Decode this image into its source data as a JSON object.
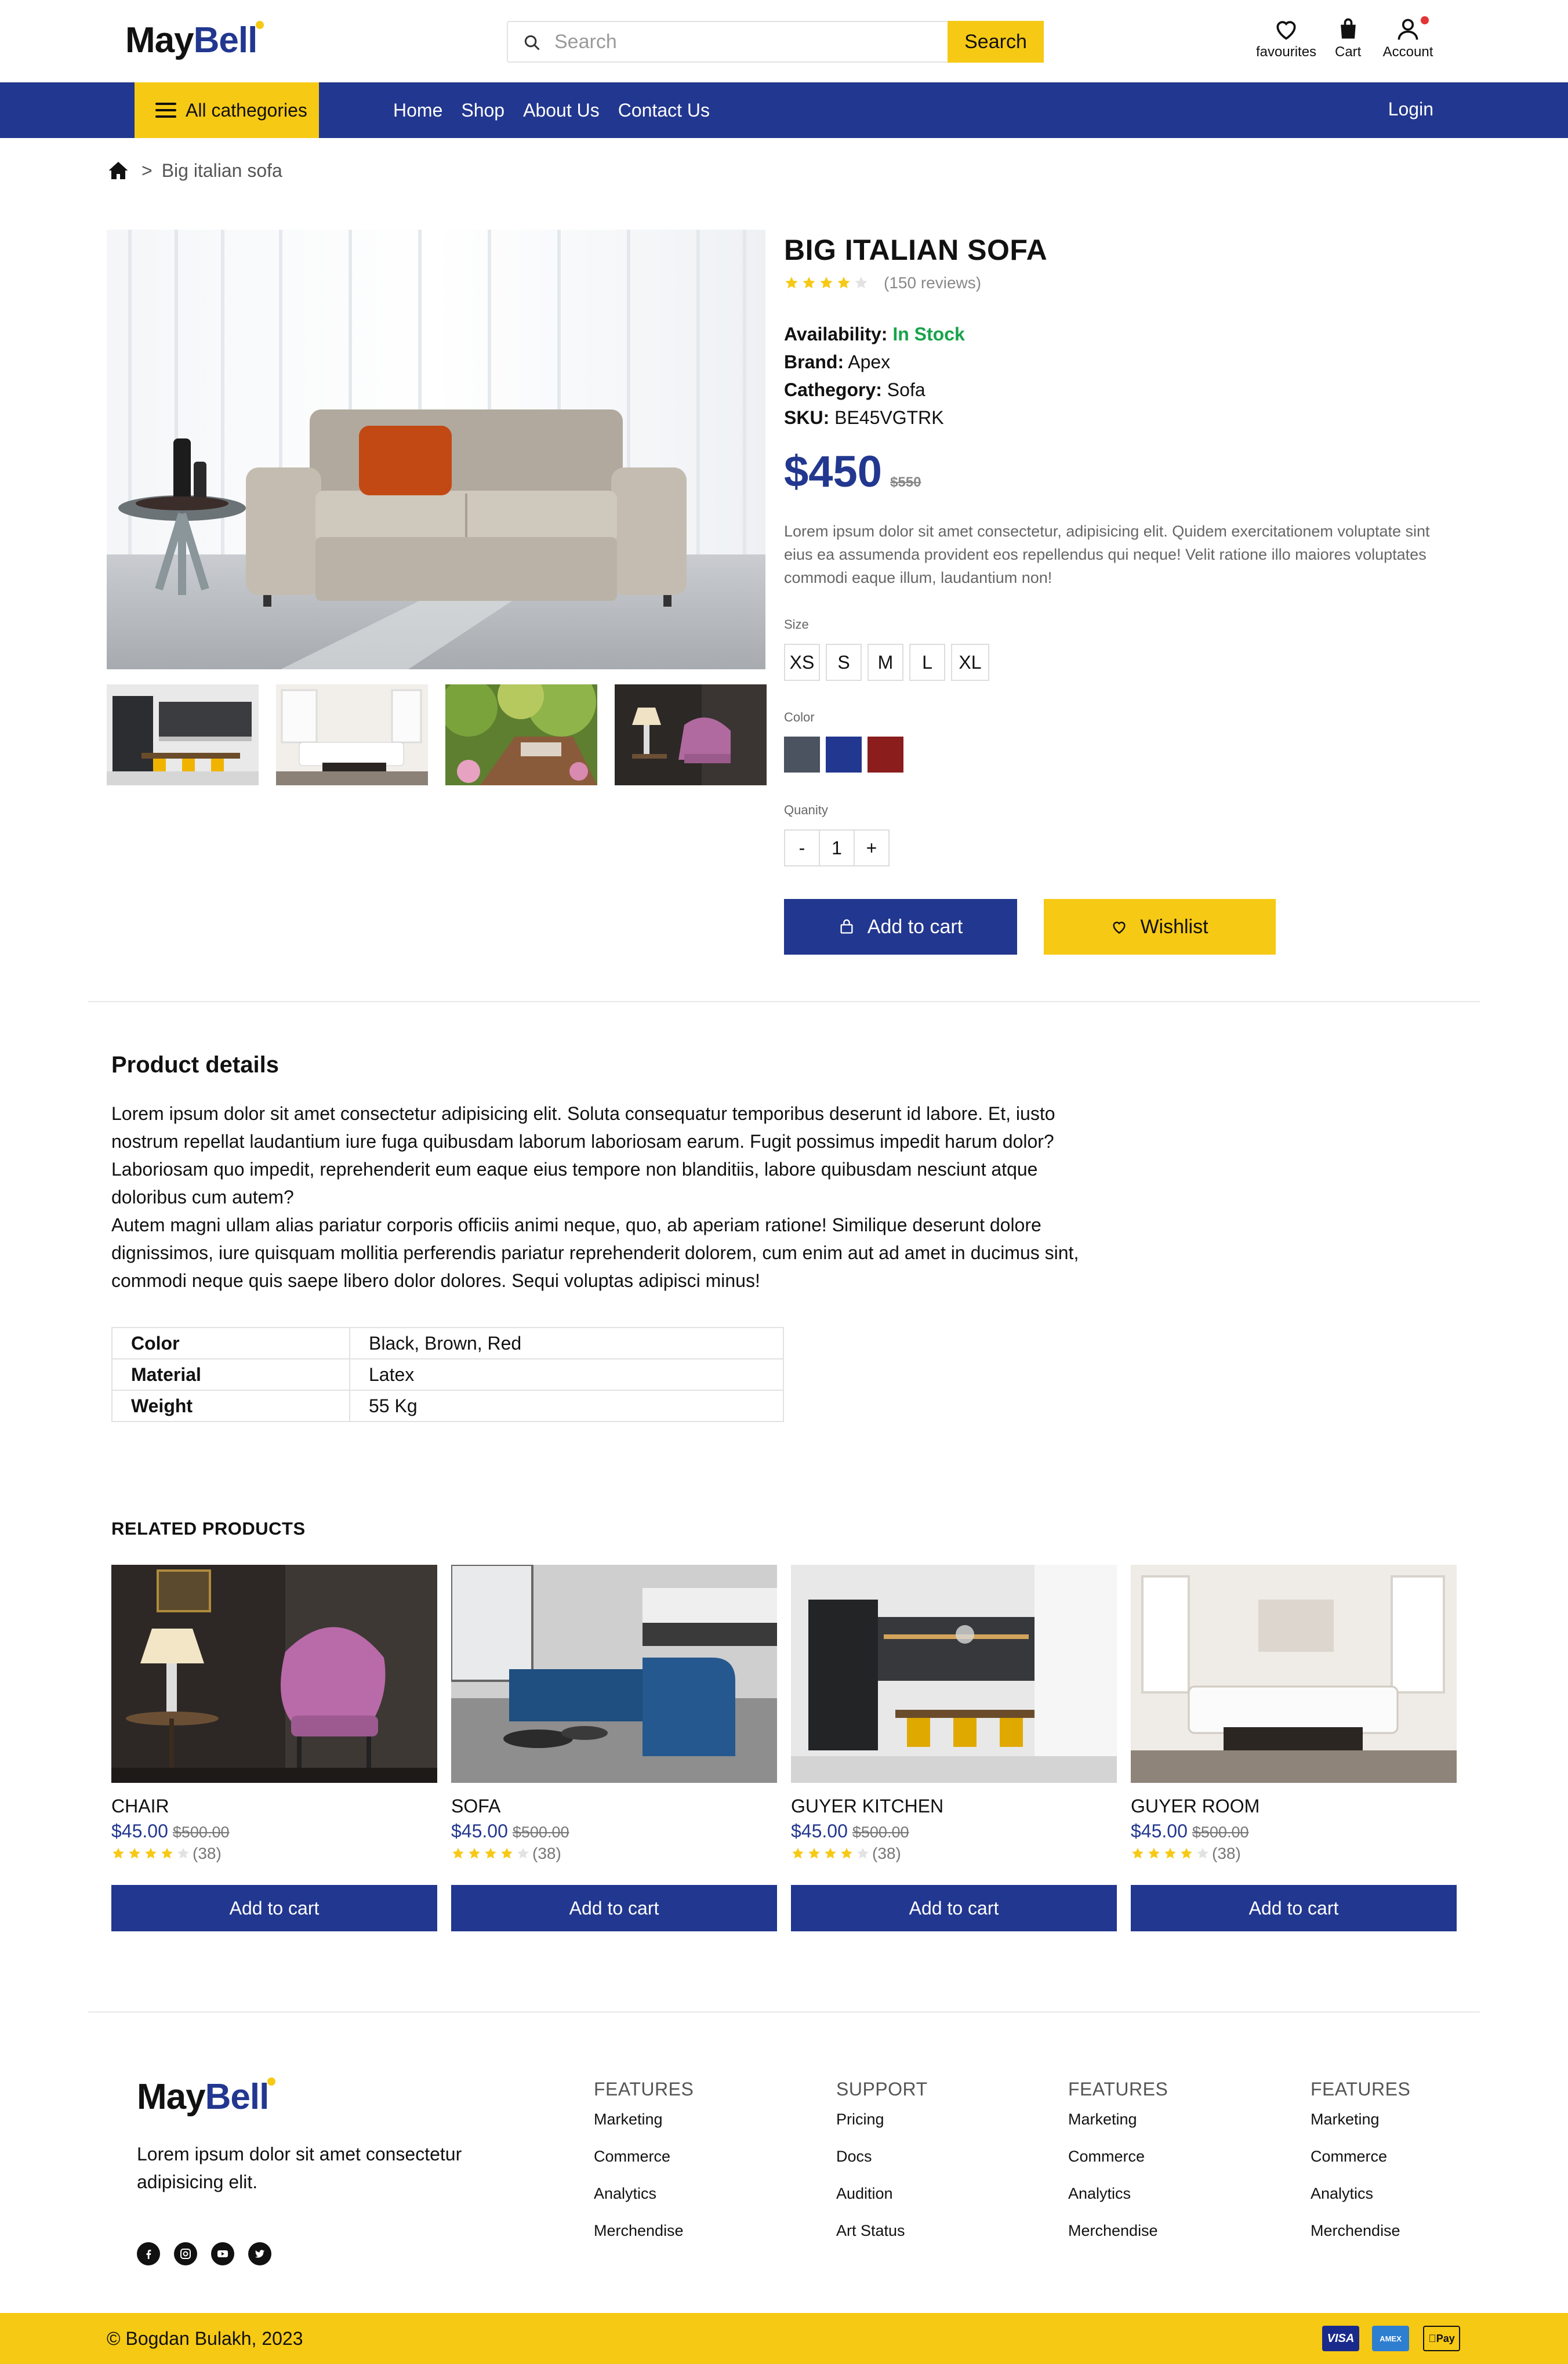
{
  "header": {
    "logo_part1": "May",
    "logo_part2": "Bell",
    "search_placeholder": "Search",
    "search_button": "Search",
    "favourites": "favourites",
    "cart": "Cart",
    "account": "Account"
  },
  "nav": {
    "categories": "All cathegories",
    "links": [
      "Home",
      "Shop",
      "About Us",
      "Contact Us"
    ],
    "login": "Login"
  },
  "breadcrumb": {
    "separator": ">",
    "current": "Big italian sofa"
  },
  "product": {
    "title": "BIG ITALIAN SOFA",
    "rating": 4,
    "reviews": "(150 reviews)",
    "availability_label": "Availability:",
    "availability": "In Stock",
    "brand_label": "Brand:",
    "brand": "Apex",
    "category_label": "Cathegory:",
    "category": "Sofa",
    "sku_label": "SKU:",
    "sku": "BE45VGTRK",
    "price": "$450",
    "old_price": "$550",
    "description": "Lorem ipsum dolor sit amet consectetur, adipisicing elit. Quidem exercitationem voluptate sint eius ea assumenda provident eos repellendus qui neque! Velit ratione illo maiores voluptates commodi eaque illum, laudantium non!",
    "size_label": "Size",
    "sizes": [
      "XS",
      "S",
      "M",
      "L",
      "XL"
    ],
    "color_label": "Color",
    "colors": [
      "#4b5260",
      "#22378f",
      "#8b1d1d"
    ],
    "quantity_label": "Quanity",
    "qty_minus": "-",
    "quantity": "1",
    "qty_plus": "+",
    "add_to_cart": "Add to cart",
    "wishlist": "Wishlist"
  },
  "details": {
    "title": "Product details",
    "para1": "Lorem ipsum dolor sit amet consectetur adipisicing elit. Soluta consequatur temporibus deserunt id labore. Et, iusto nostrum repellat laudantium iure fuga quibusdam laborum laboriosam earum. Fugit possimus impedit harum dolor? Laboriosam quo impedit, reprehenderit eum eaque eius tempore non blanditiis, labore quibusdam nesciunt atque doloribus cum autem?",
    "para2": "Autem magni ullam alias pariatur corporis officiis animi neque, quo, ab aperiam ratione! Similique deserunt dolore dignissimos, iure quisquam mollitia perferendis pariatur reprehenderit dolorem, cum enim aut ad amet in ducimus sint, commodi neque quis saepe libero dolor dolores. Sequi voluptas adipisci minus!",
    "specs": [
      {
        "key": "Color",
        "value": "Black, Brown, Red"
      },
      {
        "key": "Material",
        "value": "Latex"
      },
      {
        "key": "Weight",
        "value": "55 Kg"
      }
    ]
  },
  "related": {
    "title": "RELATED PRODUCTS",
    "items": [
      {
        "name": "CHAIR",
        "price": "$45.00",
        "old": "$500.00",
        "count": "(38)",
        "button": "Add to cart",
        "rating": 4
      },
      {
        "name": "SOFA",
        "price": "$45.00",
        "old": "$500.00",
        "count": "(38)",
        "button": "Add to cart",
        "rating": 4
      },
      {
        "name": "GUYER KITCHEN",
        "price": "$45.00",
        "old": "$500.00",
        "count": "(38)",
        "button": "Add to cart",
        "rating": 4
      },
      {
        "name": "GUYER ROOM",
        "price": "$45.00",
        "old": "$500.00",
        "count": "(38)",
        "button": "Add to cart",
        "rating": 4
      }
    ]
  },
  "footer": {
    "tagline": "Lorem ipsum dolor sit amet consectetur adipisicing elit.",
    "columns": [
      {
        "title": "FEATURES",
        "links": [
          "Marketing",
          "Commerce",
          "Analytics",
          "Merchendise"
        ]
      },
      {
        "title": "SUPPORT",
        "links": [
          "Pricing",
          "Docs",
          "Audition",
          "Art Status"
        ]
      },
      {
        "title": "FEATURES",
        "links": [
          "Marketing",
          "Commerce",
          "Analytics",
          "Merchendise"
        ]
      },
      {
        "title": "FEATURES",
        "links": [
          "Marketing",
          "Commerce",
          "Analytics",
          "Merchendise"
        ]
      }
    ],
    "copyright": "© Bogdan Bulakh, 2023",
    "payments": [
      "VISA",
      "AMEX",
      "Pay"
    ]
  },
  "theme": {
    "primary": "#22378f",
    "accent": "#f6c915",
    "success": "#17a34a",
    "alert": "#e33535"
  }
}
